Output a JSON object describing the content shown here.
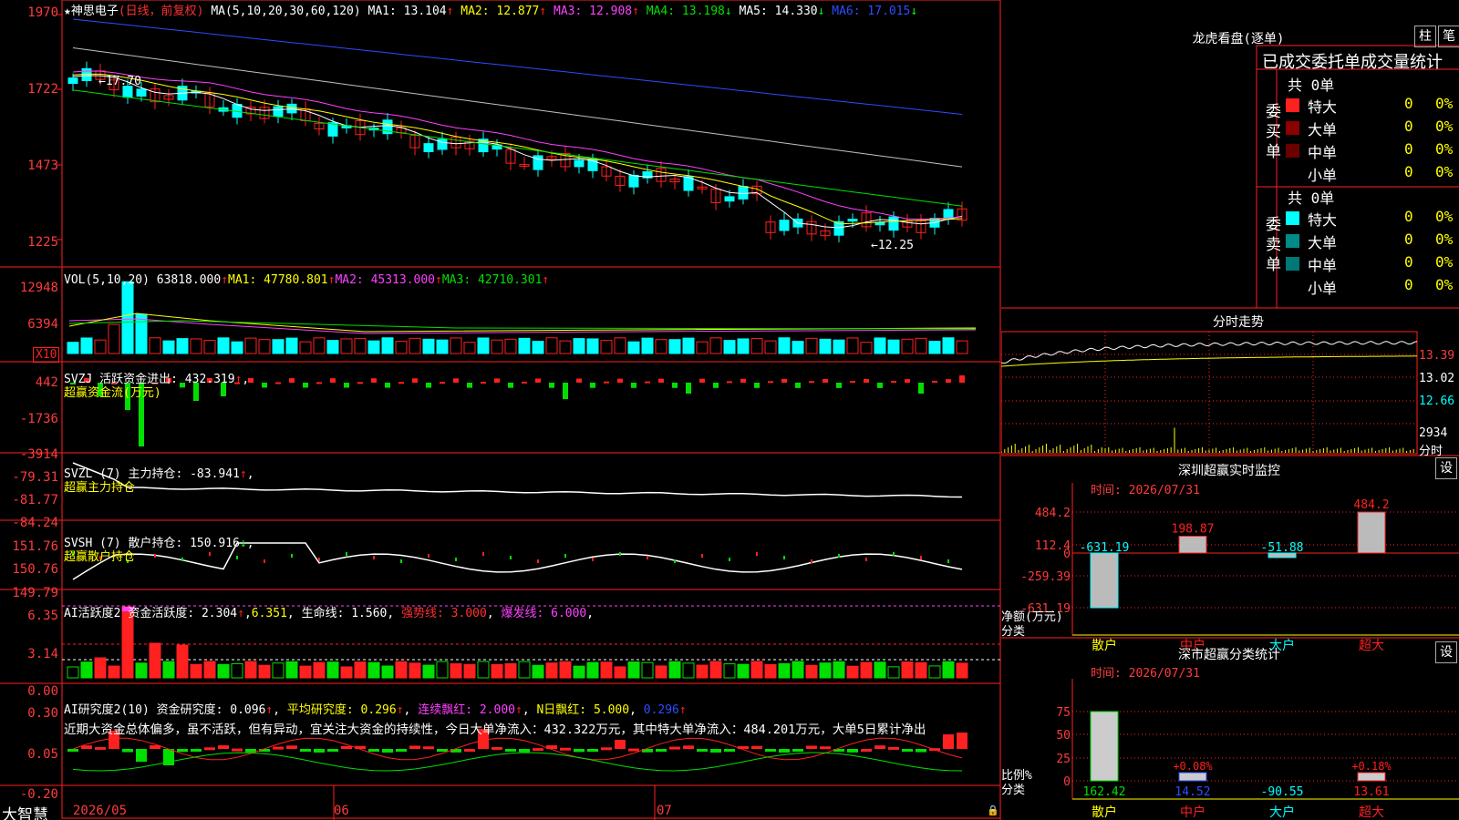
{
  "colors": {
    "up": "#ff2020",
    "down": "#00ffff",
    "ma1": "#ffffff",
    "ma2": "#ffff00",
    "ma3": "#ff40ff",
    "ma4": "#00e000",
    "ma5": "#c0c0c0",
    "ma6": "#2e4cff",
    "frame": "#ff2020"
  },
  "main": {
    "star": "★",
    "stock_name": "神思电子",
    "period": "(日线，前复权)",
    "ma_params": "MA(5,10,20,30,60,120)",
    "ma1": "MA1: 13.104",
    "ma1_arrow": "↑",
    "ma2": "MA2: 12.877",
    "ma2_arrow": "↑",
    "ma3": "MA3: 12.908",
    "ma3_arrow": "↑",
    "ma4": "MA4: 13.198",
    "ma4_arrow": "↓",
    "ma5": "MA5: 14.330",
    "ma5_arrow": "↓",
    "ma6": "MA6: 17.015",
    "ma6_arrow": "↓",
    "y_ticks": [
      "1970",
      "1722",
      "1473",
      "1225"
    ],
    "high_mark": "←17.70",
    "low_mark": "←12.25"
  },
  "vol": {
    "label": "VOL(5,10,20)",
    "value": "63818.000",
    "value_arrow": "↑",
    "ma1": "MA1: 47780.801",
    "ma1_arrow": "↑",
    "ma2": "MA2: 45313.000",
    "ma2_arrow": "↑",
    "ma3": "MA3: 42710.301",
    "ma3_arrow": "↑",
    "y_ticks": [
      "12948",
      "6394"
    ],
    "unit": "X10"
  },
  "svzj": {
    "label": "SVZJ",
    "desc": "活跃资金进出: 432.319",
    "arrow": "↑",
    "sub": "超赢资金流(万元)",
    "y_ticks": [
      "442",
      "-1736",
      "-3914"
    ]
  },
  "svzl": {
    "label": "SVZL (7)",
    "desc": "主力持仓: -83.941",
    "arrow": "↑",
    "sub": "超赢主力持仓",
    "y_ticks": [
      "-79.31",
      "-81.77",
      "-84.24"
    ]
  },
  "svsh": {
    "label": "SVSH (7)",
    "desc": "散户持仓: 150.916",
    "arrow": "↓",
    "sub": "超赢散户持仓",
    "y_ticks": [
      "151.76",
      "150.76",
      "149.79"
    ]
  },
  "ai1": {
    "label": "AI活跃度2",
    "desc1": "资金活跃度: 2.304",
    "desc1_arrow": "↑",
    "desc2": "6.351",
    "desc3": "生命线: 1.560",
    "desc4": "强势线: 3.000",
    "desc5": "爆发线: 6.000",
    "y_ticks": [
      "6.35",
      "3.14",
      "0.00"
    ]
  },
  "ai2": {
    "label": "AI研究度2(10)",
    "desc1": "资金研究度: 0.096",
    "desc1_arrow": "↑",
    "desc2": "平均研究度: 0.296",
    "desc2_arrow": "↑",
    "desc3": "连续飘红: 2.000",
    "desc3_arrow": "↑",
    "desc4": "N日飘红: 5.000",
    "desc5": "0.296",
    "desc5_arrow": "↑",
    "commentary": "近期大资金总体偏多，虽不活跃，但有异动，宜关注大资金的持续性，今日大单净流入：432.322万元，其中特大单净流入：484.201万元，大单5日累计净出",
    "y_ticks": [
      "0.30",
      "0.05",
      "-0.20"
    ]
  },
  "xaxis": {
    "brand": "大智慧",
    "labels": [
      "2026/05",
      "06",
      "07"
    ]
  },
  "lhb": {
    "title": "龙虎看盘(逐单)",
    "btn1": "柱",
    "btn2": "笔",
    "subtitle": "已成交委托单成交量统计",
    "buy": {
      "side": "委买单",
      "total": "共 0单",
      "rows": [
        {
          "name": "特大",
          "count": "0",
          "pct": "0%"
        },
        {
          "name": "大单",
          "count": "0",
          "pct": "0%"
        },
        {
          "name": "中单",
          "count": "0",
          "pct": "0%"
        },
        {
          "name": "小单",
          "count": "0",
          "pct": "0%"
        }
      ]
    },
    "sell": {
      "side": "委卖单",
      "total": "共 0单",
      "rows": [
        {
          "name": "特大",
          "count": "0",
          "pct": "0%"
        },
        {
          "name": "大单",
          "count": "0",
          "pct": "0%"
        },
        {
          "name": "中单",
          "count": "0",
          "pct": "0%"
        },
        {
          "name": "小单",
          "count": "0",
          "pct": "0%"
        }
      ]
    }
  },
  "fenshi": {
    "title": "分时走势",
    "y_ticks": [
      "13.39",
      "13.02",
      "12.66",
      "2934"
    ],
    "x_label": "分时"
  },
  "sz_monitor": {
    "title": "深圳超赢实时监控",
    "btn": "设",
    "time": "时间: 2026/07/31",
    "y_ticks": [
      "484.2",
      "112.4",
      "0",
      "-259.39",
      "-631.19"
    ],
    "ylabel": "净额(万元)",
    "xlabel": "分类",
    "categories": [
      "散户",
      "中户",
      "大户",
      "超大"
    ],
    "values": [
      -631.19,
      198.87,
      -51.88,
      484.2
    ],
    "value_labels": [
      "-631.19",
      "198.87",
      "-51.88",
      "484.2"
    ]
  },
  "sz_stats": {
    "title": "深市超赢分类统计",
    "btn": "设",
    "time": "时间: 2026/07/31",
    "y_ticks": [
      "75",
      "50",
      "25",
      "0"
    ],
    "ylabel": "比例%",
    "xlabel": "分类",
    "categories": [
      "散户",
      "中户",
      "大户",
      "超大"
    ],
    "values": [
      162.42,
      14.52,
      -90.55,
      13.61
    ],
    "value_labels": [
      "162.42",
      "14.52",
      "-90.55",
      "13.61"
    ],
    "pct_labels": [
      "",
      "+0.08%",
      "",
      "+0.18%"
    ]
  }
}
